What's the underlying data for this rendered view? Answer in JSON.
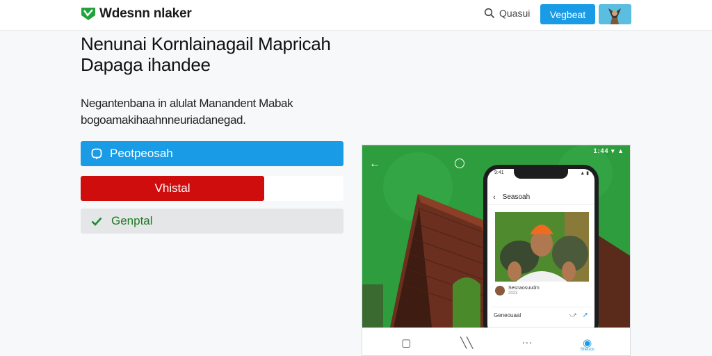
{
  "header": {
    "brand": "Wdesnn nlaker",
    "search_label": "Quasui",
    "primary_button": "Vegbeat"
  },
  "hero": {
    "title": "Nenunai Kornlainagail Mapricah Dapaga ihandee",
    "subtitle": "Negantenbana in alulat Manandent Mabak bogoamakihaahnneuriadanegad."
  },
  "actions": {
    "blue_label": "Peotpeosah",
    "red_label": "Vhistal",
    "gray_label": "Genptal"
  },
  "preview": {
    "status_text": "1:44 ▾ ▲",
    "phone_time": "9:41",
    "phone_status": "▲ ▮",
    "phone_title": "Seasoah",
    "post_author": "Sesnaosuudm",
    "post_meta": "2023",
    "post_footer_label": "Geneouaal",
    "bottom_nav": [
      "▢",
      "╲╲",
      "···",
      "◉"
    ],
    "bottom_nav_active_label": "Sheuos"
  },
  "colors": {
    "accent_blue": "#1a9be6",
    "accent_red": "#d00d0d",
    "accent_green": "#1e7a26",
    "photo_green": "#2e9d3e"
  },
  "icons": {
    "logo": "logo-icon",
    "search": "search-icon",
    "blue_button": "chat-icon",
    "gray_button": "check-icon"
  }
}
